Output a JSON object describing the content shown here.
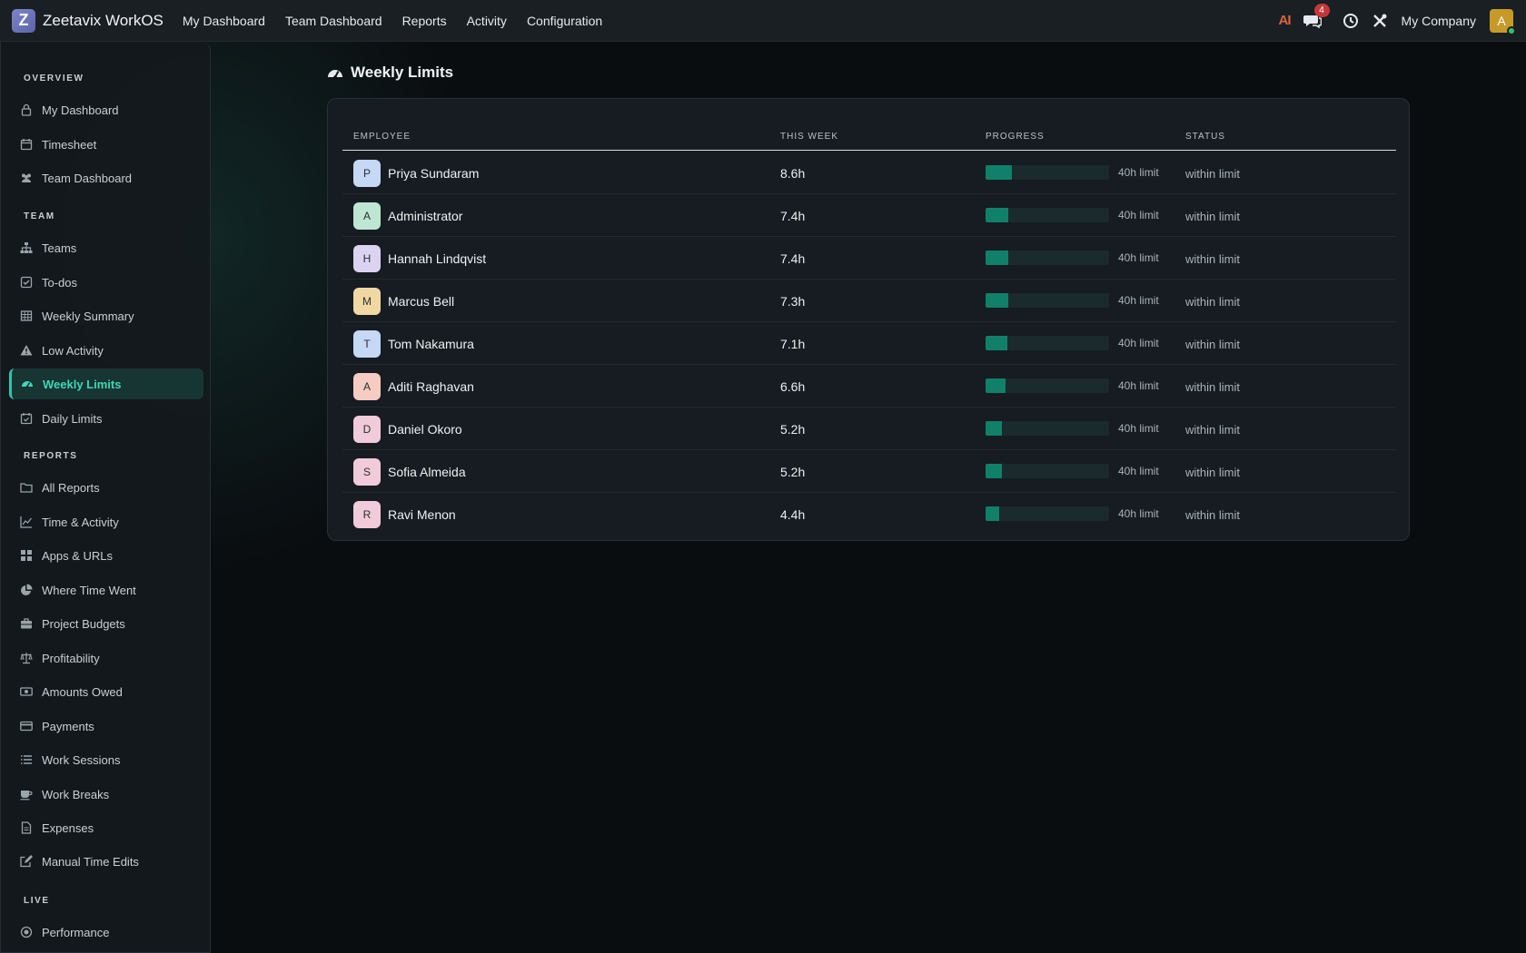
{
  "app": {
    "name": "Zeetavix WorkOS",
    "logo_letter": "Z"
  },
  "topnav": [
    "My Dashboard",
    "Team Dashboard",
    "Reports",
    "Activity",
    "Configuration"
  ],
  "topbar": {
    "ai_label": "AI",
    "chat_badge": "4",
    "company": "My Company",
    "avatar_letter": "A"
  },
  "sidebar": {
    "overview_title": "OVERVIEW",
    "team_title": "TEAM",
    "reports_title": "REPORTS",
    "live_title": "LIVE",
    "items": [
      "My Dashboard",
      "Timesheet",
      "Team Dashboard",
      "Teams",
      "To-dos",
      "Weekly Summary",
      "Low Activity",
      "Weekly Limits",
      "Daily Limits",
      "All Reports",
      "Time & Activity",
      "Apps & URLs",
      "Where Time Went",
      "Project Budgets",
      "Profitability",
      "Amounts Owed",
      "Payments",
      "Work Sessions",
      "Work Breaks",
      "Expenses",
      "Manual Time Edits",
      "Performance"
    ]
  },
  "page": {
    "title": "Weekly Limits"
  },
  "table": {
    "headers": {
      "employee": "EMPLOYEE",
      "this_week": "THIS WEEK",
      "progress": "PROGRESS",
      "status": "STATUS"
    },
    "rows": [
      {
        "initial": "P",
        "name": "Priya Sundaram",
        "hours": "8.6h",
        "progress": 0.215,
        "limit": "40h limit",
        "status": "within limit",
        "color": "#c5d8f5"
      },
      {
        "initial": "A",
        "name": "Administrator",
        "hours": "7.4h",
        "progress": 0.185,
        "limit": "40h limit",
        "status": "within limit",
        "color": "#bfe6d2"
      },
      {
        "initial": "H",
        "name": "Hannah Lindqvist",
        "hours": "7.4h",
        "progress": 0.185,
        "limit": "40h limit",
        "status": "within limit",
        "color": "#dcd3f3"
      },
      {
        "initial": "M",
        "name": "Marcus Bell",
        "hours": "7.3h",
        "progress": 0.1825,
        "limit": "40h limit",
        "status": "within limit",
        "color": "#f1d7a2"
      },
      {
        "initial": "T",
        "name": "Tom Nakamura",
        "hours": "7.1h",
        "progress": 0.1775,
        "limit": "40h limit",
        "status": "within limit",
        "color": "#c5d8f5"
      },
      {
        "initial": "A",
        "name": "Aditi Raghavan",
        "hours": "6.6h",
        "progress": 0.165,
        "limit": "40h limit",
        "status": "within limit",
        "color": "#f5cbc2"
      },
      {
        "initial": "D",
        "name": "Daniel Okoro",
        "hours": "5.2h",
        "progress": 0.13,
        "limit": "40h limit",
        "status": "within limit",
        "color": "#f1cbd9"
      },
      {
        "initial": "S",
        "name": "Sofia Almeida",
        "hours": "5.2h",
        "progress": 0.13,
        "limit": "40h limit",
        "status": "within limit",
        "color": "#f1cbd9"
      },
      {
        "initial": "R",
        "name": "Ravi Menon",
        "hours": "4.4h",
        "progress": 0.11,
        "limit": "40h limit",
        "status": "within limit",
        "color": "#f1cbd9"
      }
    ]
  }
}
